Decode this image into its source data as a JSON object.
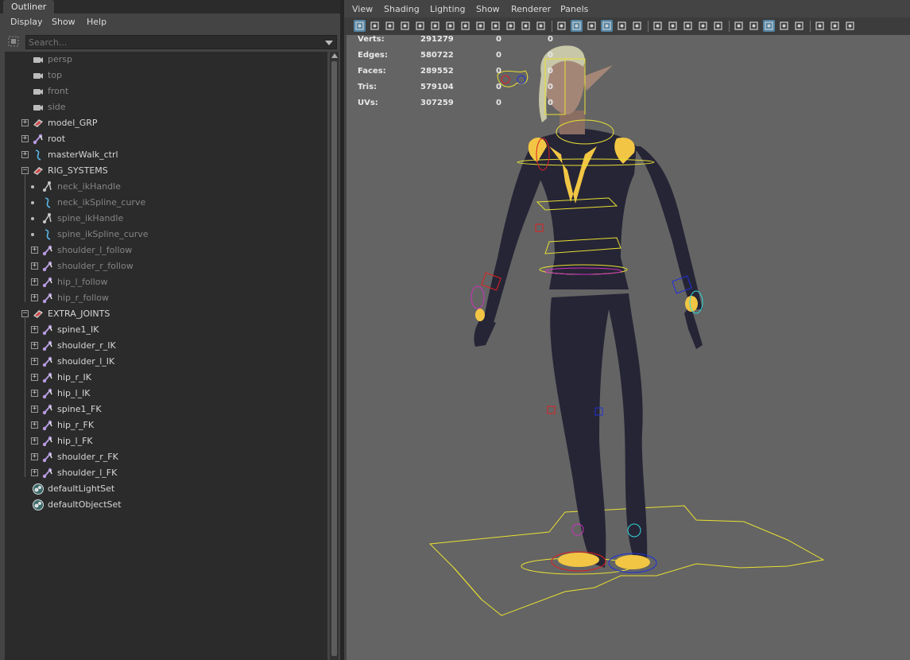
{
  "outliner": {
    "tab_label": "Outliner",
    "menu": [
      "Display",
      "Show",
      "Help"
    ],
    "search_placeholder": "Search...",
    "items": [
      {
        "label": "persp",
        "icon": "camera-icon",
        "depth": 0,
        "expander": "none",
        "dim": true
      },
      {
        "label": "top",
        "icon": "camera-icon",
        "depth": 0,
        "expander": "none",
        "dim": true
      },
      {
        "label": "front",
        "icon": "camera-icon",
        "depth": 0,
        "expander": "none",
        "dim": true
      },
      {
        "label": "side",
        "icon": "camera-icon",
        "depth": 0,
        "expander": "none",
        "dim": true
      },
      {
        "label": "model_GRP",
        "icon": "group-icon",
        "depth": 0,
        "expander": "plus",
        "dim": false
      },
      {
        "label": "root",
        "icon": "joint-icon",
        "depth": 0,
        "expander": "plus",
        "dim": false
      },
      {
        "label": "masterWalk_ctrl",
        "icon": "curve-icon",
        "depth": 0,
        "expander": "plus",
        "dim": false
      },
      {
        "label": "RIG_SYSTEMS",
        "icon": "group-icon",
        "depth": 0,
        "expander": "minus",
        "dim": false
      },
      {
        "label": "neck_ikHandle",
        "icon": "ik-handle-icon",
        "depth": 1,
        "expander": "dot",
        "dim": true
      },
      {
        "label": "neck_ikSpline_curve",
        "icon": "curve-icon",
        "depth": 1,
        "expander": "dot",
        "dim": true
      },
      {
        "label": "spine_ikHandle",
        "icon": "ik-handle-icon",
        "depth": 1,
        "expander": "dot",
        "dim": true
      },
      {
        "label": "spine_ikSpline_curve",
        "icon": "curve-icon",
        "depth": 1,
        "expander": "dot",
        "dim": true
      },
      {
        "label": "shoulder_l_follow",
        "icon": "joint-icon",
        "depth": 1,
        "expander": "plus",
        "dim": true
      },
      {
        "label": "shoulder_r_follow",
        "icon": "joint-icon",
        "depth": 1,
        "expander": "plus",
        "dim": true
      },
      {
        "label": "hip_l_follow",
        "icon": "joint-icon",
        "depth": 1,
        "expander": "plus",
        "dim": true
      },
      {
        "label": "hip_r_follow",
        "icon": "joint-icon",
        "depth": 1,
        "expander": "plus",
        "dim": true
      },
      {
        "label": "EXTRA_JOINTS",
        "icon": "group-icon",
        "depth": 0,
        "expander": "minus",
        "dim": false
      },
      {
        "label": "spine1_IK",
        "icon": "joint-icon",
        "depth": 1,
        "expander": "plus",
        "dim": false
      },
      {
        "label": "shoulder_r_IK",
        "icon": "joint-icon",
        "depth": 1,
        "expander": "plus",
        "dim": false
      },
      {
        "label": "shoulder_l_IK",
        "icon": "joint-icon",
        "depth": 1,
        "expander": "plus",
        "dim": false
      },
      {
        "label": "hip_r_IK",
        "icon": "joint-icon",
        "depth": 1,
        "expander": "plus",
        "dim": false
      },
      {
        "label": "hip_l_IK",
        "icon": "joint-icon",
        "depth": 1,
        "expander": "plus",
        "dim": false
      },
      {
        "label": "spine1_FK",
        "icon": "joint-icon",
        "depth": 1,
        "expander": "plus",
        "dim": false
      },
      {
        "label": "hip_r_FK",
        "icon": "joint-icon",
        "depth": 1,
        "expander": "plus",
        "dim": false
      },
      {
        "label": "hip_l_FK",
        "icon": "joint-icon",
        "depth": 1,
        "expander": "plus",
        "dim": false
      },
      {
        "label": "shoulder_r_FK",
        "icon": "joint-icon",
        "depth": 1,
        "expander": "plus",
        "dim": false
      },
      {
        "label": "shoulder_l_FK",
        "icon": "joint-icon",
        "depth": 1,
        "expander": "plus",
        "dim": false
      },
      {
        "label": "defaultLightSet",
        "icon": "set-icon",
        "depth": 0,
        "expander": "none",
        "dim": false
      },
      {
        "label": "defaultObjectSet",
        "icon": "set-icon",
        "depth": 0,
        "expander": "none",
        "dim": false
      }
    ]
  },
  "viewport": {
    "menu": [
      "View",
      "Shading",
      "Lighting",
      "Show",
      "Renderer",
      "Panels"
    ],
    "toolbar_icons": [
      "select-camera-icon",
      "camera-attributes-icon",
      "bookmark-icon",
      "image-plane-icon",
      "grease-pencil-icon",
      "2d-pan-zoom-icon",
      "lock-camera-icon",
      "film-gate-icon",
      "resolution-gate-icon",
      "gate-mask-icon",
      "field-chart-icon",
      "safe-action-icon",
      "safe-title-icon",
      "wireframe-icon",
      "smooth-shade-icon",
      "wireframe-on-shaded-icon",
      "textured-icon",
      "use-lights-icon",
      "shadows-icon",
      "ambient-occlusion-icon",
      "motion-blur-icon",
      "anti-alias-icon",
      "depth-of-field-icon",
      "isolate-select-icon",
      "xray-icon",
      "xray-joints-icon",
      "xray-active-icon",
      "grid-icon",
      "display-gamma-icon",
      "panel-layout-icon",
      "single-pane-icon",
      "four-pane-icon"
    ],
    "hud": {
      "rows": [
        {
          "label": "Verts:",
          "values": [
            "291279",
            "0",
            "0"
          ]
        },
        {
          "label": "Edges:",
          "values": [
            "580722",
            "0",
            "0"
          ]
        },
        {
          "label": "Faces:",
          "values": [
            "289552",
            "0",
            "0"
          ]
        },
        {
          "label": "Tris:",
          "values": [
            "579104",
            "0",
            "0"
          ]
        },
        {
          "label": "UVs:",
          "values": [
            "307259",
            "0",
            "0"
          ]
        }
      ]
    }
  },
  "colors": {
    "panel_bg": "#444444",
    "tree_bg": "#2b2b2b",
    "viewport_bg": "#646464",
    "suit": "#262536",
    "skin": "#a48677",
    "accent_yellow": "#f2c644",
    "ctrl_yellow": "#e8e032",
    "ctrl_red": "#e02020",
    "ctrl_blue": "#2030d8",
    "ctrl_magenta": "#d030c0",
    "ctrl_cyan": "#30d8d8"
  }
}
